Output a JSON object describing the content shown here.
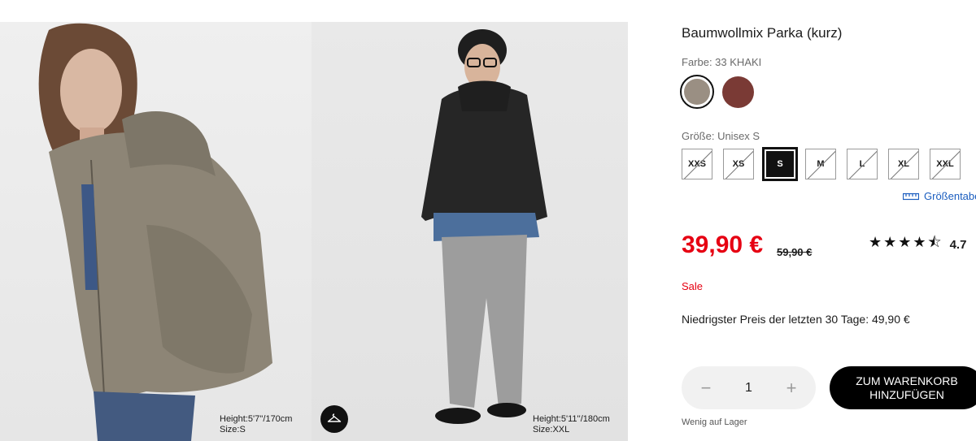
{
  "product": {
    "title": "Baumwollmix Parka (kurz)",
    "color_label": "Farbe: 33 KHAKI",
    "colors": [
      {
        "name": "33 KHAKI",
        "hex": "#9a8f83",
        "selected": true
      },
      {
        "name": "braun",
        "hex": "#7a3a35",
        "selected": false
      }
    ],
    "size_label": "Größe: Unisex S",
    "sizes": [
      {
        "label": "XXS",
        "available": false,
        "selected": false
      },
      {
        "label": "XS",
        "available": false,
        "selected": false
      },
      {
        "label": "S",
        "available": true,
        "selected": true
      },
      {
        "label": "M",
        "available": false,
        "selected": false
      },
      {
        "label": "L",
        "available": false,
        "selected": false
      },
      {
        "label": "XL",
        "available": false,
        "selected": false
      },
      {
        "label": "XXL",
        "available": false,
        "selected": false
      }
    ],
    "size_table_link": "Größentabelle",
    "price": "39,90 €",
    "old_price": "59,90 €",
    "rating_stars": "★★★★⯪",
    "rating_value": "4.7",
    "sale_label": "Sale",
    "lowest_price": "Niedrigster Preis der letzten 30 Tage: 49,90 €",
    "quantity": "1",
    "qty_minus": "−",
    "qty_plus": "+",
    "cart_line1": "ZUM WARENKORB",
    "cart_line2": "HINZUFÜGEN",
    "stock": "Wenig auf Lager"
  },
  "gallery": {
    "left_model": {
      "height": "Height:5'7''/170cm",
      "size": "Size:S"
    },
    "right_model": {
      "height": "Height:5'11''/180cm",
      "size": "Size:XXL"
    }
  },
  "colors": {
    "sale_red": "#e60012",
    "link_blue": "#1a5dbf",
    "black": "#000000"
  }
}
